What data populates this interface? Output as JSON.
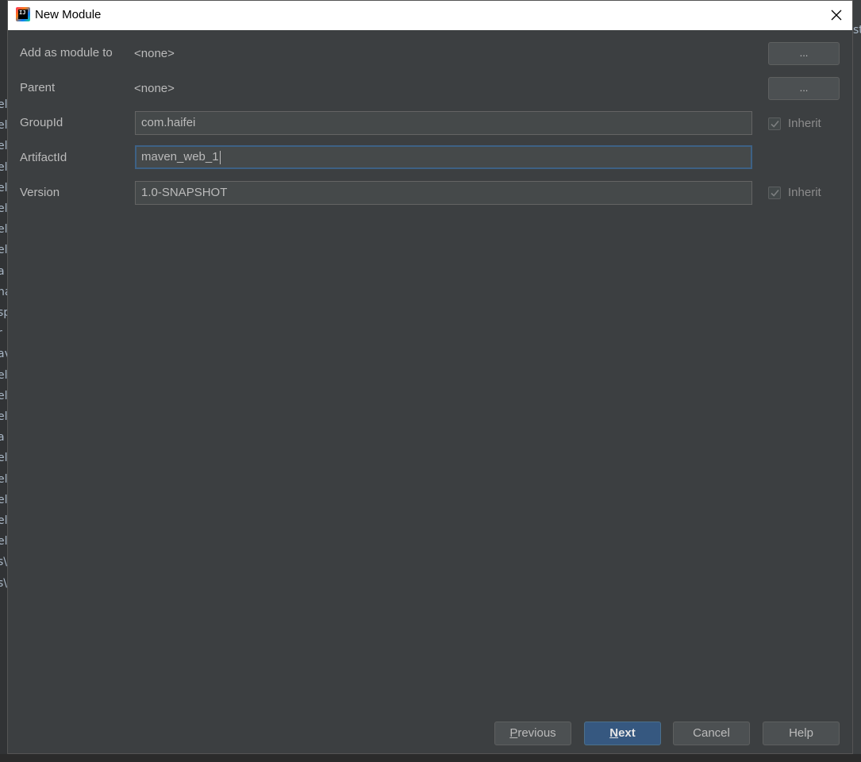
{
  "window": {
    "title": "New Module",
    "icon": "intellij-idea-icon"
  },
  "background": {
    "left_fragments": [
      "el",
      "el",
      "el",
      "el",
      "el",
      "el",
      "el",
      "el",
      "a",
      "na",
      "sp",
      "r",
      "av",
      "el",
      "el",
      "el",
      "a",
      "el",
      "el",
      "el",
      "el",
      "el",
      "s\\",
      "s\\"
    ],
    "right_fragment": "st"
  },
  "form": {
    "add_as_module_to": {
      "label": "Add as module to",
      "value": "<none>",
      "browse_label": "..."
    },
    "parent": {
      "label": "Parent",
      "value": "<none>",
      "browse_label": "..."
    },
    "group_id": {
      "label": "GroupId",
      "value": "com.haifei",
      "inherit_label": "Inherit",
      "inherit_checked": true
    },
    "artifact_id": {
      "label": "ArtifactId",
      "value": "maven_web_1"
    },
    "version": {
      "label": "Version",
      "value": "1.0-SNAPSHOT",
      "inherit_label": "Inherit",
      "inherit_checked": true
    }
  },
  "buttons": {
    "previous": {
      "mnemonic": "P",
      "rest": "revious"
    },
    "next": {
      "mnemonic": "N",
      "rest": "ext"
    },
    "cancel": "Cancel",
    "help": "Help"
  },
  "colors": {
    "dialog_bg": "#3c3f41",
    "input_bg": "#45494a",
    "primary_button": "#365880",
    "focus_border": "#3d6185",
    "text": "#bbbbbb"
  }
}
